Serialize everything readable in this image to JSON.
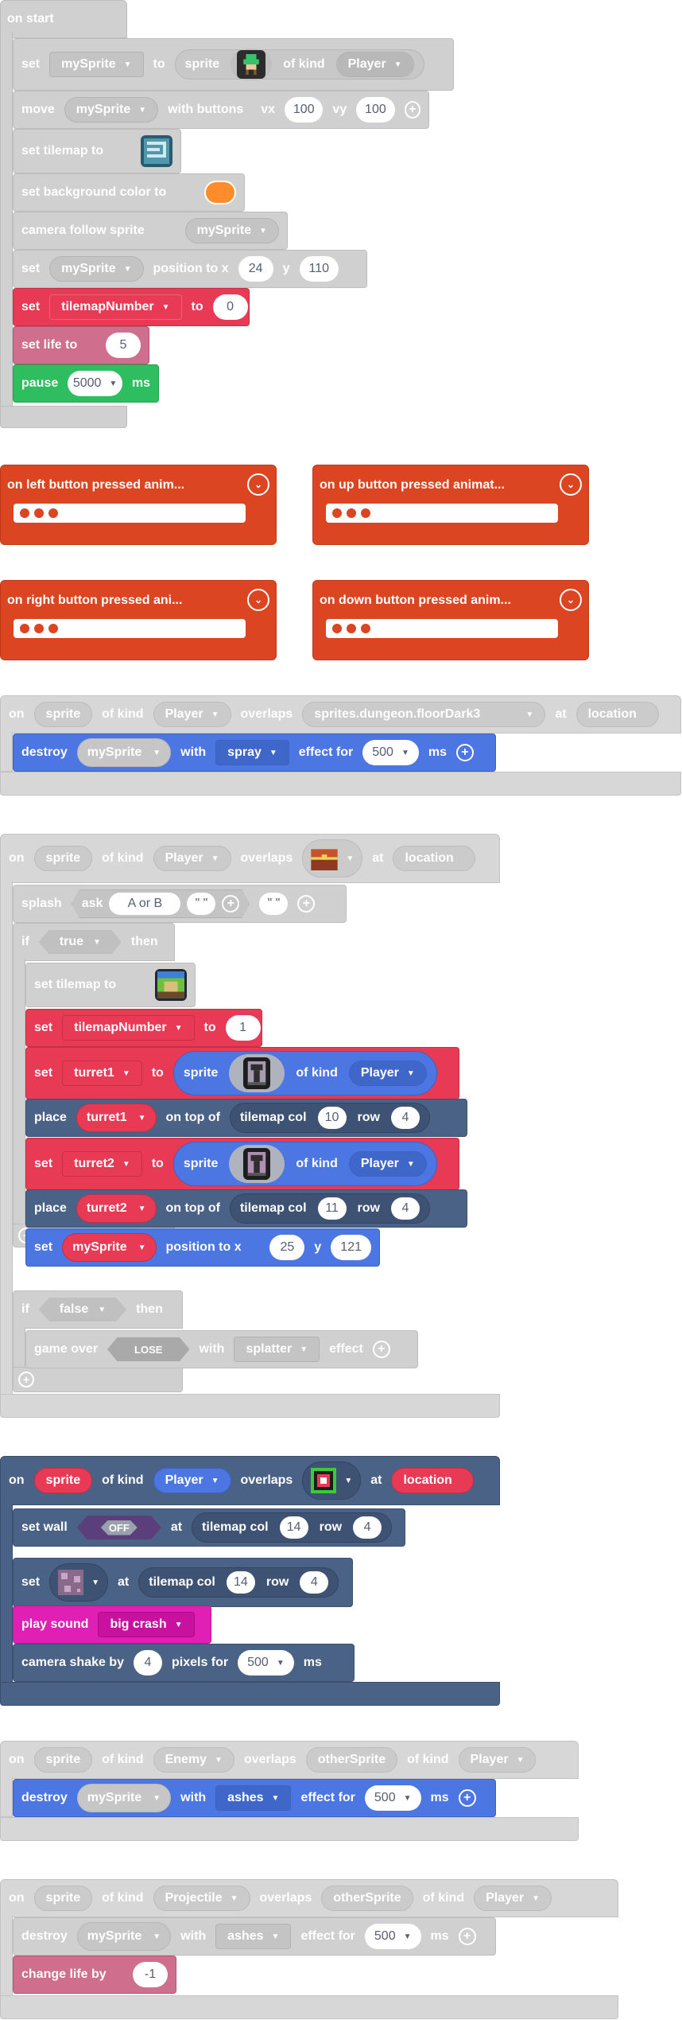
{
  "colors": {
    "gray": "#d0d0d0",
    "red": "#e83a55",
    "pink": "#cf6e8d",
    "green": "#2ebd5f",
    "blue": "#4c76e2",
    "slate": "#4b6287",
    "magenta": "#e01fb5",
    "orange": "#dc4521",
    "bg_orange": "#ff8c2b"
  },
  "on_start": {
    "hat": "on start",
    "set": "set",
    "my_sprite": "mySprite",
    "to": "to",
    "sprite": "sprite",
    "of_kind": "of kind",
    "player": "Player",
    "move": "move",
    "with_buttons": "with buttons",
    "vx": "vx",
    "vx_val": "100",
    "vy": "vy",
    "vy_val": "100",
    "set_tilemap": "set tilemap to",
    "set_bg": "set background color to",
    "camera_follow": "camera follow sprite",
    "position_x": "position to x",
    "x_val": "24",
    "y": "y",
    "y_val": "110",
    "tilemap_number": "tilemapNumber",
    "tn_val": "0",
    "set_life": "set life to",
    "life_val": "5",
    "pause": "pause",
    "pause_val": "5000",
    "ms": "ms"
  },
  "collapsed": [
    {
      "label": "on left button pressed anim...",
      "icon": "chevron-down-icon"
    },
    {
      "label": "on up button pressed animat...",
      "icon": "chevron-down-icon"
    },
    {
      "label": "on right button pressed ani...",
      "icon": "chevron-down-icon"
    },
    {
      "label": "on down button pressed anim...",
      "icon": "chevron-down-icon"
    }
  ],
  "overlap_tile": {
    "on": "on",
    "sprite": "sprite",
    "of_kind": "of kind",
    "player": "Player",
    "overlaps": "overlaps",
    "tile": "sprites.dungeon.floorDark3",
    "at": "at",
    "location": "location",
    "destroy": "destroy",
    "my_sprite": "mySprite",
    "with": "with",
    "effect": "spray",
    "effect_for": "effect for",
    "dur": "500",
    "ms": "ms"
  },
  "overlap_chest": {
    "on": "on",
    "sprite": "sprite",
    "of_kind": "of kind",
    "player": "Player",
    "overlaps": "overlaps",
    "at": "at",
    "location": "location",
    "splash": "splash",
    "ask": "ask",
    "a_or_b": "A or B",
    "q1": "\" \"",
    "q2": "\" \"",
    "if": "if",
    "true": "true",
    "then": "then",
    "set_tilemap": "set tilemap to",
    "set": "set",
    "tilemap_number": "tilemapNumber",
    "to": "to",
    "tn_val": "1",
    "turret1": "turret1",
    "sprite_lbl": "sprite",
    "kind_player": "Player",
    "place": "place",
    "on_top_of": "on top of",
    "tilemap_col": "tilemap col",
    "col1": "10",
    "row": "row",
    "row1": "4",
    "turret2": "turret2",
    "col2": "11",
    "row2": "4",
    "my_sprite": "mySprite",
    "position_x": "position to x",
    "x_val": "25",
    "y": "y",
    "y_val": "121",
    "false": "false",
    "game_over": "game over",
    "lose": "LOSE",
    "with": "with",
    "splatter": "splatter",
    "effect": "effect"
  },
  "overlap_wall": {
    "on": "on",
    "sprite": "sprite",
    "of_kind": "of kind",
    "player": "Player",
    "overlaps": "overlaps",
    "at": "at",
    "location": "location",
    "set_wall": "set wall",
    "off": "OFF",
    "tilemap_col": "tilemap col",
    "col": "14",
    "row": "row",
    "row_val": "4",
    "set": "set",
    "col2": "14",
    "row2": "4",
    "play_sound": "play sound",
    "sound": "big crash",
    "camera_shake": "camera shake by",
    "shake": "4",
    "pixels_for": "pixels for",
    "shake_ms": "500",
    "ms": "ms"
  },
  "overlap_enemy": {
    "on": "on",
    "sprite": "sprite",
    "of_kind": "of kind",
    "enemy": "Enemy",
    "overlaps": "overlaps",
    "other": "otherSprite",
    "player": "Player",
    "destroy": "destroy",
    "my_sprite": "mySprite",
    "with": "with",
    "effect": "ashes",
    "effect_for": "effect for",
    "dur": "500",
    "ms": "ms"
  },
  "overlap_proj": {
    "on": "on",
    "sprite": "sprite",
    "of_kind": "of kind",
    "projectile": "Projectile",
    "overlaps": "overlaps",
    "other": "otherSprite",
    "player": "Player",
    "destroy": "destroy",
    "my_sprite": "mySprite",
    "with": "with",
    "effect": "ashes",
    "effect_for": "effect for",
    "dur": "500",
    "ms": "ms",
    "change_life": "change life by",
    "life_delta": "-1"
  }
}
